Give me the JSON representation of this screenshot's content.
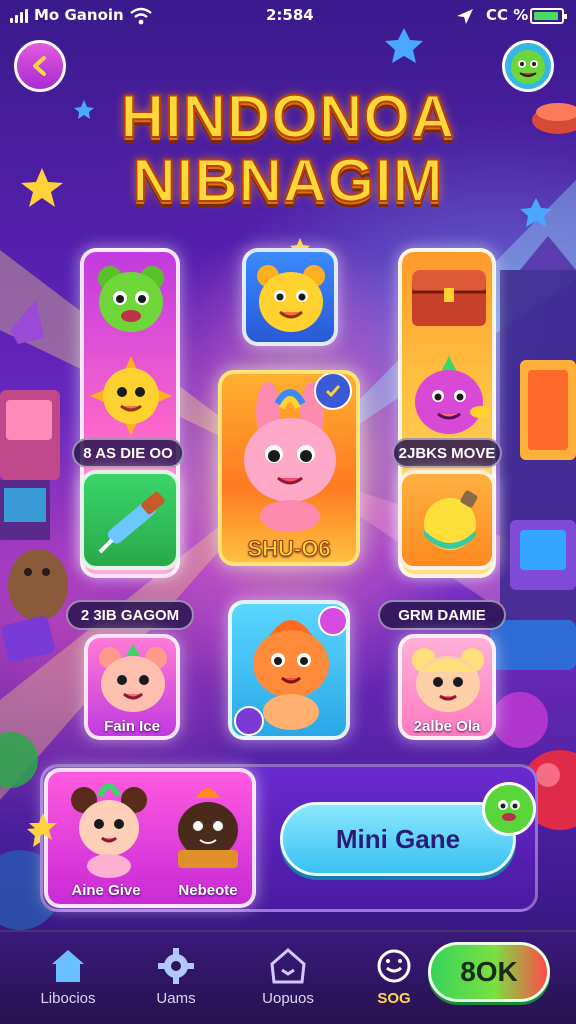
{
  "status_bar": {
    "carrier": "Mo Ganoin",
    "time": "2:584",
    "battery_text": "CC %"
  },
  "header": {
    "back_icon": "chevron-left-icon",
    "profile_icon": "green-monster-avatar-icon",
    "title_line1": "HINDONOA",
    "title_line2": "NIBNAGIM"
  },
  "cards": {
    "left_badge": "8 AS DIE OO",
    "right_badge": "2JBKS MOVE",
    "featured_badge": "SHU-O6",
    "left_bottom_badge": "2 3IB GAGOM",
    "left_bottom_caption": "Fain Ice",
    "right_bottom_badge": "GRM DAMIE",
    "right_bottom_caption": "2albe Ola"
  },
  "bottom_panel": {
    "char1_label": "Aine Give",
    "char2_label": "Nebeote",
    "mini_game_label": "Mini Gane"
  },
  "tabbar": {
    "tabs": [
      {
        "label": "Libocios",
        "icon": "home-icon"
      },
      {
        "label": "Uams",
        "icon": "gear-icon"
      },
      {
        "label": "Uopuos",
        "icon": "house-outline-icon"
      },
      {
        "label": "SOG",
        "icon": "clock-icon"
      }
    ],
    "ok_label": "OK",
    "ok_prefix": "8"
  },
  "colors": {
    "title_yellow": "#ffd93a",
    "mini_game_blue": "#5fd8ff",
    "ok_green": "#37d45a",
    "active_tab_yellow": "#ffd84a"
  }
}
